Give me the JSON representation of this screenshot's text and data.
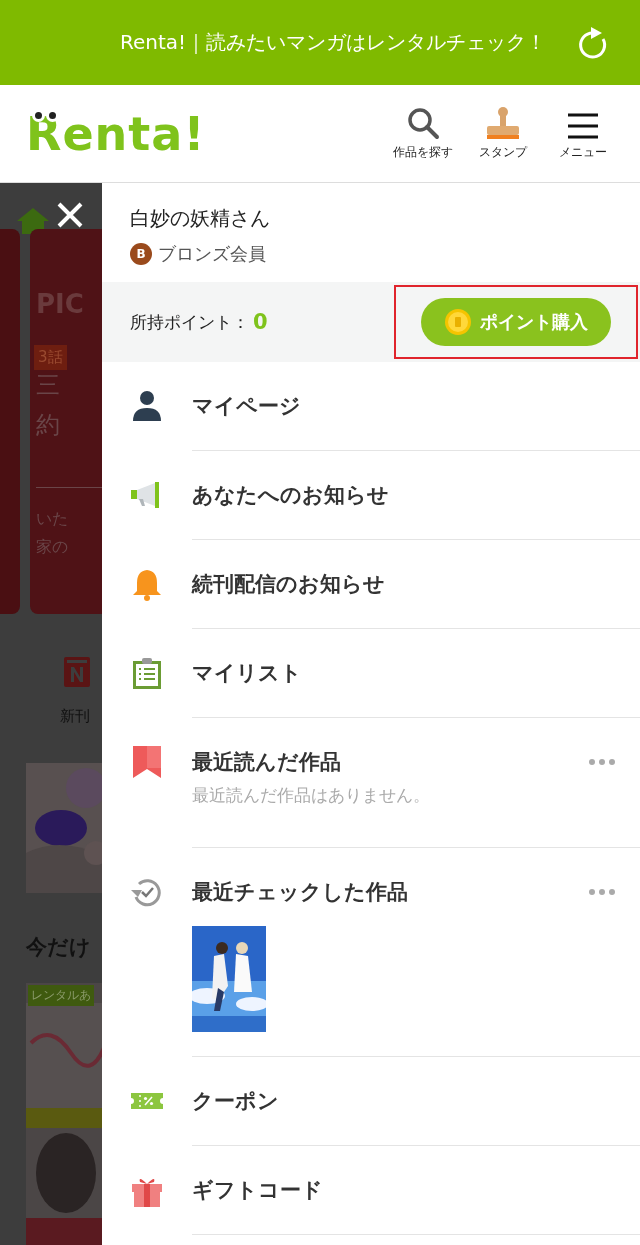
{
  "status_bar": {
    "title": "Renta!｜読みたいマンガはレンタルチェック！"
  },
  "header": {
    "logo": "Renta!",
    "actions": [
      {
        "kind": "search",
        "label": "作品を探す"
      },
      {
        "kind": "stamp",
        "label": "スタンプ"
      },
      {
        "kind": "menu",
        "label": "メニュー"
      }
    ]
  },
  "background": {
    "card_title": "PIC",
    "card_badge": "3話",
    "card_lines": [
      "三",
      "約"
    ],
    "card_text": [
      "いた",
      "家の"
    ],
    "nav_label": "新刊",
    "section_title": "今だけ",
    "rental_badge": "レンタルあ"
  },
  "drawer": {
    "user_name": "白妙の妖精さん",
    "rank_badge": "B",
    "rank": "ブロンズ会員",
    "points_label": "所持ポイント：",
    "points": "0",
    "buy_button": "ポイント購入",
    "buy_highlighted": true,
    "items": [
      {
        "kind": "mypage",
        "label": "マイページ"
      },
      {
        "kind": "news",
        "label": "あなたへのお知らせ"
      },
      {
        "kind": "bell",
        "label": "続刊配信のお知らせ"
      },
      {
        "kind": "mylist",
        "label": "マイリスト"
      },
      {
        "kind": "bookmark",
        "label": "最近読んだ作品",
        "more": true,
        "empty_text": "最近読んだ作品はありません。"
      },
      {
        "kind": "history",
        "label": "最近チェックした作品",
        "more": true
      },
      {
        "kind": "coupon",
        "label": "クーポン"
      },
      {
        "kind": "gift",
        "label": "ギフトコード"
      }
    ]
  }
}
